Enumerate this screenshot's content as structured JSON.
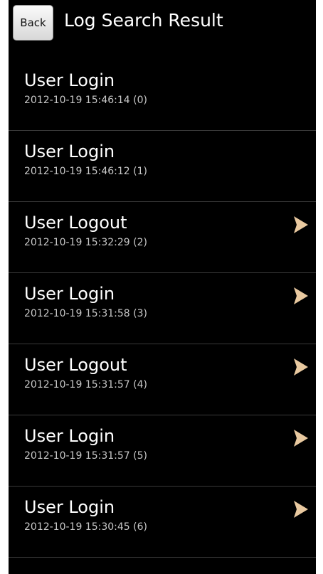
{
  "header": {
    "back_label": "Back",
    "title": "Log Search Result"
  },
  "rows": [
    {
      "title": "User Login",
      "subtitle": "2012-10-19 15:46:14 (0)",
      "has_arrow": false
    },
    {
      "title": "User Login",
      "subtitle": "2012-10-19 15:46:12 (1)",
      "has_arrow": false
    },
    {
      "title": "User Logout",
      "subtitle": "2012-10-19 15:32:29 (2)",
      "has_arrow": true
    },
    {
      "title": "User Login",
      "subtitle": "2012-10-19 15:31:58 (3)",
      "has_arrow": true
    },
    {
      "title": "User Logout",
      "subtitle": "2012-10-19 15:31:57 (4)",
      "has_arrow": true
    },
    {
      "title": "User Login",
      "subtitle": "2012-10-19 15:31:57 (5)",
      "has_arrow": true
    },
    {
      "title": "User Login",
      "subtitle": "2012-10-19 15:30:45 (6)",
      "has_arrow": true
    }
  ],
  "colors": {
    "background": "#000000",
    "text": "#ffffff",
    "subtext": "#c8c8c8",
    "divider": "#3a3a3a",
    "arrow": "#e9c9a0"
  },
  "icons": {
    "row_arrow": "chevron-right-icon"
  }
}
